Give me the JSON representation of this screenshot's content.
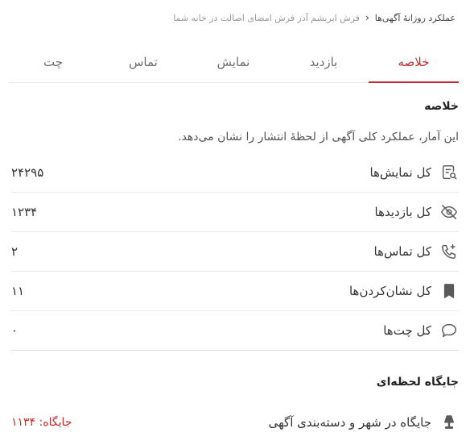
{
  "breadcrumb": {
    "first": "عملکرد روزانهٔ آگهی‌ها",
    "separator": "‹",
    "second": "فرش ابریشم آذر فرش امضای اصالت در خانه شما"
  },
  "tabs": [
    {
      "label": "خلاصه",
      "active": true
    },
    {
      "label": "بازدید",
      "active": false
    },
    {
      "label": "نمایش",
      "active": false
    },
    {
      "label": "تماس",
      "active": false
    },
    {
      "label": "چت",
      "active": false
    }
  ],
  "summary": {
    "title": "خلاصه",
    "description": "این آمار، عملکرد کلی آگهی از لحظهٔ انتشار را نشان می‌دهد.",
    "stats": [
      {
        "label": "کل نمایش‌ها",
        "value": "۲۴۲۹۵",
        "icon": "search-document-icon"
      },
      {
        "label": "کل بازدیدها",
        "value": "۱۲۳۴",
        "icon": "eye-off-icon"
      },
      {
        "label": "کل تماس‌ها",
        "value": "۲",
        "icon": "phone-icon"
      },
      {
        "label": "کل نشان‌کردن‌ها",
        "value": "۱۱",
        "icon": "bookmark-icon"
      },
      {
        "label": "کل چت‌ها",
        "value": "۰",
        "icon": "chat-icon"
      }
    ]
  },
  "rank": {
    "title": "جایگاه لحظه‌ای",
    "label": "جایگاه در شهر و دسته‌بندی آگهی",
    "value": "جایگاه: ۱۱۳۴",
    "icon": "lamp-icon"
  },
  "colors": {
    "accent": "#c62b2b",
    "icon": "#5a5a5a"
  }
}
